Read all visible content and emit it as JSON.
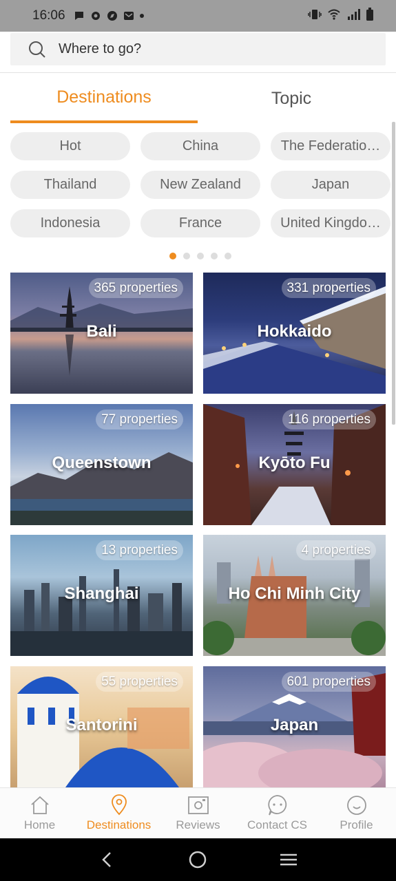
{
  "status": {
    "time": "16:06"
  },
  "search": {
    "placeholder": "Where to go?"
  },
  "tabs": [
    {
      "label": "Destinations",
      "active": true
    },
    {
      "label": "Topic",
      "active": false
    }
  ],
  "chips": [
    "Hot",
    "China",
    "The Federatio…",
    "Thailand",
    "New Zealand",
    "Japan",
    "Indonesia",
    "France",
    "United Kingdo…"
  ],
  "pager": {
    "count": 5,
    "active": 1
  },
  "cards": [
    {
      "name": "Bali",
      "properties": "365 properties"
    },
    {
      "name": "Hokkaido",
      "properties": "331 properties"
    },
    {
      "name": "Queenstown",
      "properties": "77 properties"
    },
    {
      "name": "Kyōto Fu",
      "properties": "116 properties"
    },
    {
      "name": "Shanghai",
      "properties": "13 properties"
    },
    {
      "name": "Ho Chi Minh City",
      "properties": "4 properties"
    },
    {
      "name": "Santorini",
      "properties": "55 properties"
    },
    {
      "name": "Japan",
      "properties": "601 properties"
    }
  ],
  "bottom_nav": [
    {
      "label": "Home",
      "icon": "home-icon",
      "active": false
    },
    {
      "label": "Destinations",
      "icon": "location-pin-icon",
      "active": true
    },
    {
      "label": "Reviews",
      "icon": "camera-icon",
      "active": false
    },
    {
      "label": "Contact CS",
      "icon": "chat-icon",
      "active": false
    },
    {
      "label": "Profile",
      "icon": "profile-icon",
      "active": false
    }
  ],
  "colors": {
    "accent": "#ee8c1f",
    "chip_bg": "#eeeeee",
    "status_bar": "#9e9e9e"
  }
}
